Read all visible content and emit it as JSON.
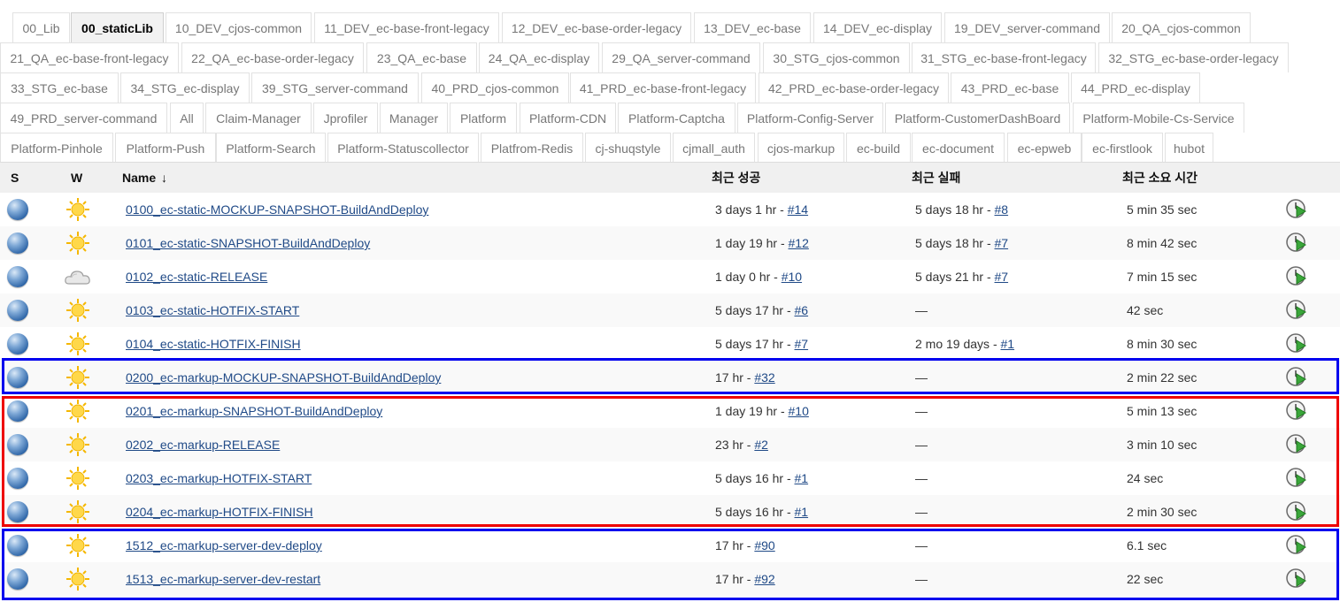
{
  "tabs": [
    "00_Lib",
    "00_staticLib",
    "10_DEV_cjos-common",
    "11_DEV_ec-base-front-legacy",
    "12_DEV_ec-base-order-legacy",
    "13_DEV_ec-base",
    "14_DEV_ec-display",
    "19_DEV_server-command",
    "20_QA_cjos-common",
    "21_QA_ec-base-front-legacy",
    "22_QA_ec-base-order-legacy",
    "23_QA_ec-base",
    "24_QA_ec-display",
    "29_QA_server-command",
    "30_STG_cjos-common",
    "31_STG_ec-base-front-legacy",
    "32_STG_ec-base-order-legacy",
    "33_STG_ec-base",
    "34_STG_ec-display",
    "39_STG_server-command",
    "40_PRD_cjos-common",
    "41_PRD_ec-base-front-legacy",
    "42_PRD_ec-base-order-legacy",
    "43_PRD_ec-base",
    "44_PRD_ec-display",
    "49_PRD_server-command",
    "All",
    "Claim-Manager",
    "Jprofiler",
    "Manager",
    "Platform",
    "Platform-CDN",
    "Platform-Captcha",
    "Platform-Config-Server",
    "Platform-CustomerDashBoard",
    "Platform-Mobile-Cs-Service",
    "Platform-Pinhole",
    "Platform-Push",
    "Platform-Search",
    "Platform-Statuscollector",
    "Platfrom-Redis",
    "cj-shuqstyle",
    "cjmall_auth",
    "cjos-markup",
    "ec-build",
    "ec-document",
    "ec-epweb",
    "ec-firstlook",
    "hubot"
  ],
  "active_tab": "00_staticLib",
  "headers": {
    "s": "S",
    "w": "W",
    "name": "Name",
    "name_sort": "↓",
    "last_success": "최근 성공",
    "last_failure": "최근 실패",
    "last_duration": "최근 소요 시간"
  },
  "jobs": [
    {
      "name": "0100_ec-static-MOCKUP-SNAPSHOT-BuildAndDeploy",
      "success_time": "3 days 1 hr - ",
      "success_build": "#14",
      "failure_time": "5 days 18 hr - ",
      "failure_build": "#8",
      "duration": "5 min 35 sec",
      "weather": "sunny"
    },
    {
      "name": "0101_ec-static-SNAPSHOT-BuildAndDeploy",
      "success_time": "1 day 19 hr - ",
      "success_build": "#12",
      "failure_time": "5 days 18 hr - ",
      "failure_build": "#7",
      "duration": "8 min 42 sec",
      "weather": "sunny"
    },
    {
      "name": "0102_ec-static-RELEASE",
      "success_time": "1 day 0 hr - ",
      "success_build": "#10",
      "failure_time": "5 days 21 hr - ",
      "failure_build": "#7",
      "duration": "7 min 15 sec",
      "weather": "cloudy"
    },
    {
      "name": "0103_ec-static-HOTFIX-START",
      "success_time": "5 days 17 hr - ",
      "success_build": "#6",
      "failure_time": "—",
      "failure_build": "",
      "duration": "42 sec",
      "weather": "sunny"
    },
    {
      "name": "0104_ec-static-HOTFIX-FINISH",
      "success_time": "5 days 17 hr - ",
      "success_build": "#7",
      "failure_time": "2 mo 19 days - ",
      "failure_build": "#1",
      "duration": "8 min 30 sec",
      "weather": "sunny"
    },
    {
      "name": "0200_ec-markup-MOCKUP-SNAPSHOT-BuildAndDeploy",
      "success_time": "17 hr - ",
      "success_build": "#32",
      "failure_time": "—",
      "failure_build": "",
      "duration": "2 min 22 sec",
      "weather": "sunny"
    },
    {
      "name": "0201_ec-markup-SNAPSHOT-BuildAndDeploy",
      "success_time": "1 day 19 hr - ",
      "success_build": "#10",
      "failure_time": "—",
      "failure_build": "",
      "duration": "5 min 13 sec",
      "weather": "sunny"
    },
    {
      "name": "0202_ec-markup-RELEASE",
      "success_time": "23 hr - ",
      "success_build": "#2",
      "failure_time": "—",
      "failure_build": "",
      "duration": "3 min 10 sec",
      "weather": "sunny"
    },
    {
      "name": "0203_ec-markup-HOTFIX-START",
      "success_time": "5 days 16 hr - ",
      "success_build": "#1",
      "failure_time": "—",
      "failure_build": "",
      "duration": "24 sec",
      "weather": "sunny"
    },
    {
      "name": "0204_ec-markup-HOTFIX-FINISH",
      "success_time": "5 days 16 hr - ",
      "success_build": "#1",
      "failure_time": "—",
      "failure_build": "",
      "duration": "2 min 30 sec",
      "weather": "sunny"
    },
    {
      "name": "1512_ec-markup-server-dev-deploy",
      "success_time": "17 hr - ",
      "success_build": "#90",
      "failure_time": "—",
      "failure_build": "",
      "duration": "6.1 sec",
      "weather": "sunny"
    },
    {
      "name": "1513_ec-markup-server-dev-restart",
      "success_time": "17 hr - ",
      "success_build": "#92",
      "failure_time": "—",
      "failure_build": "",
      "duration": "22 sec",
      "weather": "sunny"
    }
  ],
  "colors": {
    "highlight_blue": "#0000ee",
    "highlight_red": "#ee0000",
    "link": "#204a87",
    "header_bg": "#f0f0f0"
  }
}
